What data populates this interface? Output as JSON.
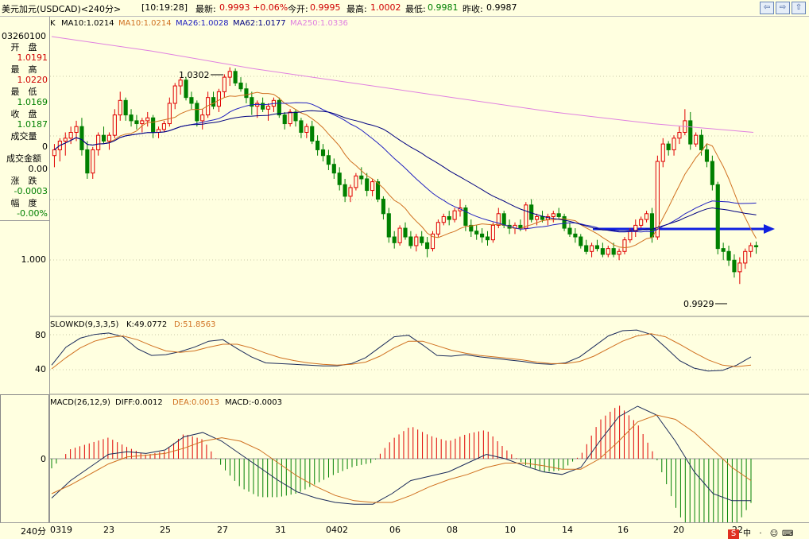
{
  "header": {
    "symbol": "美元加元(USDCAD)<240分>",
    "time": "[10:19:28]",
    "latest_label": "最新:",
    "latest_value": "0.9993 +0.06%",
    "open_label": "今开:",
    "open_value": "0.9995",
    "high_label": "最高:",
    "high_value": "1.0002",
    "low_label": "最低:",
    "low_value": "0.9981",
    "prev_label": "昨收:",
    "prev_value": "0.9987"
  },
  "nav_buttons": [
    "⇦",
    "⇨",
    "⇧"
  ],
  "ma_legend": {
    "k": "K",
    "ma10a": "MA10:1.0214",
    "ma10b": "MA10:1.0214",
    "ma26": "MA26:1.0028",
    "ma62": "MA62:1.0177",
    "ma250": "MA250:1.0336"
  },
  "info_panel": {
    "datetime": "03260100",
    "open_label": "开　盘",
    "open_value": "1.0191",
    "high_label": "最　高",
    "high_value": "1.0220",
    "low_label": "最　低",
    "low_value": "1.0169",
    "close_label": "收　盘",
    "close_value": "1.0187",
    "volume_label": "成交量",
    "volume_value": "0",
    "amount_label": "成交金额",
    "amount_value": "0.00",
    "change_label": "涨　跌",
    "change_value": "-0.0003",
    "pct_label": "幅　度",
    "pct_value": "-0.00%"
  },
  "price_axis": {
    "tick": "1.000"
  },
  "annotations": {
    "high": "1.0302",
    "low": "0.9929"
  },
  "kd": {
    "legend_name": "SLOWKD(9,3,3,5)",
    "legend_k": "K:49.0772",
    "legend_d": "D:51.8563",
    "ticks": [
      "80",
      "40"
    ]
  },
  "macd": {
    "legend_name": "MACD(26,12,9)",
    "legend_diff": "DIFF:0.0012",
    "legend_dea": "DEA:0.0013",
    "legend_macd": "MACD:-0.0003",
    "tick": "0"
  },
  "dates": {
    "period": "240分",
    "labels": [
      "0319",
      "23",
      "25",
      "27",
      "31",
      "0402",
      "06",
      "08",
      "10",
      "14",
      "16",
      "20",
      "22"
    ]
  },
  "ime": [
    "S",
    "中",
    "·",
    "☺",
    "⌨"
  ],
  "colors": {
    "up": "#E00000",
    "down": "#008000",
    "ma10": "#D07020",
    "ma26": "#2020C0",
    "ma62": "#000080",
    "ma250": "#E080E0",
    "arrow": "#1020E0"
  },
  "chart_data": {
    "type": "candlestick",
    "instrument": "USDCAD",
    "interval": "240分",
    "price_range": [
      0.988,
      1.037
    ],
    "kd_range": [
      0,
      100
    ],
    "candles_ohlc": [
      [
        1.015,
        1.017,
        1.013,
        1.016
      ],
      [
        1.016,
        1.018,
        1.014,
        1.0175
      ],
      [
        1.0175,
        1.019,
        1.015,
        1.018
      ],
      [
        1.018,
        1.02,
        1.017,
        1.019
      ],
      [
        1.019,
        1.021,
        1.0175,
        1.02
      ],
      [
        1.02,
        1.0215,
        1.015,
        1.016
      ],
      [
        1.016,
        1.0175,
        1.011,
        1.012
      ],
      [
        1.012,
        1.0165,
        1.011,
        1.016
      ],
      [
        1.016,
        1.019,
        1.015,
        1.0185
      ],
      [
        1.0185,
        1.02,
        1.017,
        1.0175
      ],
      [
        1.0175,
        1.019,
        1.016,
        1.0185
      ],
      [
        1.0185,
        1.023,
        1.018,
        1.022
      ],
      [
        1.022,
        1.026,
        1.021,
        1.0245
      ],
      [
        1.0245,
        1.025,
        1.021,
        1.022
      ],
      [
        1.022,
        1.023,
        1.02,
        1.021
      ],
      [
        1.021,
        1.022,
        1.0195,
        1.0205
      ],
      [
        1.0205,
        1.0215,
        1.019,
        1.021
      ],
      [
        1.021,
        1.0225,
        1.02,
        1.0215
      ],
      [
        1.0215,
        1.022,
        1.018,
        1.019
      ],
      [
        1.019,
        1.02,
        1.018,
        1.0195
      ],
      [
        1.0195,
        1.021,
        1.019,
        1.0205
      ],
      [
        1.0205,
        1.025,
        1.02,
        1.024
      ],
      [
        1.024,
        1.0275,
        1.023,
        1.027
      ],
      [
        1.027,
        1.0285,
        1.0255,
        1.028
      ],
      [
        1.028,
        1.0285,
        1.0245,
        1.025
      ],
      [
        1.025,
        1.026,
        1.023,
        1.024
      ],
      [
        1.024,
        1.0245,
        1.02,
        1.021
      ],
      [
        1.021,
        1.023,
        1.0195,
        1.022
      ],
      [
        1.022,
        1.026,
        1.0215,
        1.025
      ],
      [
        1.025,
        1.026,
        1.023,
        1.0235
      ],
      [
        1.0235,
        1.0265,
        1.0225,
        1.026
      ],
      [
        1.026,
        1.029,
        1.025,
        1.0285
      ],
      [
        1.0285,
        1.0302,
        1.027,
        1.0295
      ],
      [
        1.0295,
        1.03,
        1.027,
        1.0275
      ],
      [
        1.0275,
        1.0285,
        1.026,
        1.0265
      ],
      [
        1.0265,
        1.0275,
        1.024,
        1.025
      ],
      [
        1.025,
        1.026,
        1.022,
        1.0235
      ],
      [
        1.0235,
        1.0245,
        1.0215,
        1.024
      ],
      [
        1.024,
        1.025,
        1.0225,
        1.023
      ],
      [
        1.023,
        1.024,
        1.021,
        1.0235
      ],
      [
        1.0235,
        1.025,
        1.0225,
        1.0245
      ],
      [
        1.0245,
        1.025,
        1.0215,
        1.022
      ],
      [
        1.022,
        1.0225,
        1.0195,
        1.0205
      ],
      [
        1.0205,
        1.023,
        1.02,
        1.0225
      ],
      [
        1.0225,
        1.023,
        1.02,
        1.021
      ],
      [
        1.021,
        1.0215,
        1.018,
        1.019
      ],
      [
        1.019,
        1.0205,
        1.018,
        1.02
      ],
      [
        1.02,
        1.021,
        1.017,
        1.0175
      ],
      [
        1.0175,
        1.0185,
        1.015,
        1.016
      ],
      [
        1.016,
        1.017,
        1.014,
        1.015
      ],
      [
        1.015,
        1.016,
        1.0125,
        1.0135
      ],
      [
        1.0135,
        1.0145,
        1.011,
        1.012
      ],
      [
        1.012,
        1.013,
        1.009,
        1.01
      ],
      [
        1.01,
        1.011,
        1.007,
        1.008
      ],
      [
        1.008,
        1.01,
        1.007,
        1.0095
      ],
      [
        1.0095,
        1.012,
        1.009,
        1.0115
      ],
      [
        1.0115,
        1.013,
        1.01,
        1.011
      ],
      [
        1.011,
        1.012,
        1.008,
        1.009
      ],
      [
        1.009,
        1.011,
        1.008,
        1.0105
      ],
      [
        1.0105,
        1.011,
        1.007,
        1.0075
      ],
      [
        1.0075,
        1.008,
        1.004,
        1.005
      ],
      [
        1.005,
        1.006,
        1.0,
        1.001
      ],
      [
        1.001,
        1.002,
        0.999,
        1.0
      ],
      [
        1.0,
        1.003,
        0.9995,
        1.0025
      ],
      [
        1.0025,
        1.0035,
        1.0005,
        1.001
      ],
      [
        1.001,
        1.002,
        0.999,
        0.9995
      ],
      [
        0.9995,
        1.0015,
        0.9985,
        1.001
      ],
      [
        1.001,
        1.002,
        0.9995,
        1.0
      ],
      [
        1.0,
        1.001,
        0.9975,
        0.999
      ],
      [
        0.999,
        1.002,
        0.9985,
        1.0015
      ],
      [
        1.0015,
        1.004,
        1.001,
        1.0035
      ],
      [
        1.0035,
        1.005,
        1.003,
        1.0045
      ],
      [
        1.0045,
        1.0055,
        1.003,
        1.004
      ],
      [
        1.004,
        1.006,
        1.0035,
        1.0055
      ],
      [
        1.0055,
        1.0075,
        1.0045,
        1.006
      ],
      [
        1.006,
        1.0065,
        1.002,
        1.003
      ],
      [
        1.003,
        1.004,
        1.001,
        1.002
      ],
      [
        1.002,
        1.003,
        1.0005,
        1.0015
      ],
      [
        1.0015,
        1.0025,
        1.0,
        1.001
      ],
      [
        1.001,
        1.002,
        0.9995,
        1.0005
      ],
      [
        1.0005,
        1.0035,
        1.0,
        1.003
      ],
      [
        1.003,
        1.006,
        1.0025,
        1.005
      ],
      [
        1.005,
        1.0055,
        1.0025,
        1.003
      ],
      [
        1.003,
        1.004,
        1.0015,
        1.0025
      ],
      [
        1.0025,
        1.0035,
        1.0015,
        1.003
      ],
      [
        1.003,
        1.004,
        1.002,
        1.0025
      ],
      [
        1.0025,
        1.007,
        1.002,
        1.0065
      ],
      [
        1.0065,
        1.0075,
        1.0035,
        1.004
      ],
      [
        1.004,
        1.005,
        1.003,
        1.0045
      ],
      [
        1.0045,
        1.0055,
        1.0035,
        1.004
      ],
      [
        1.004,
        1.005,
        1.003,
        1.0045
      ],
      [
        1.0045,
        1.0055,
        1.0035,
        1.005
      ],
      [
        1.005,
        1.006,
        1.004,
        1.0045
      ],
      [
        1.0045,
        1.005,
        1.002,
        1.0025
      ],
      [
        1.0025,
        1.0035,
        1.001,
        1.0015
      ],
      [
        1.0015,
        1.0025,
        1.0,
        1.001
      ],
      [
        1.001,
        1.0015,
        0.999,
        0.9995
      ],
      [
        0.9995,
        1.0005,
        0.998,
        0.9985
      ],
      [
        0.9985,
        1.0,
        0.9975,
        0.9995
      ],
      [
        0.9995,
        1.0005,
        0.9985,
        0.999
      ],
      [
        0.999,
        1.0,
        0.9975,
        0.998
      ],
      [
        0.998,
        0.9995,
        0.9975,
        0.999
      ],
      [
        0.999,
        1.0,
        0.9975,
        0.998
      ],
      [
        0.998,
        0.999,
        0.997,
        0.9985
      ],
      [
        0.9985,
        1.001,
        0.998,
        1.0005
      ],
      [
        1.0005,
        1.0025,
        1.0,
        1.002
      ],
      [
        1.002,
        1.004,
        1.001,
        1.003
      ],
      [
        1.003,
        1.0045,
        1.0025,
        1.004
      ],
      [
        1.004,
        1.0055,
        1.0035,
        1.005
      ],
      [
        1.005,
        1.006,
        1.0,
        1.001
      ],
      [
        1.001,
        1.015,
        1.0005,
        1.014
      ],
      [
        1.014,
        1.018,
        1.013,
        1.017
      ],
      [
        1.017,
        1.0175,
        1.015,
        1.016
      ],
      [
        1.016,
        1.0185,
        1.015,
        1.018
      ],
      [
        1.018,
        1.02,
        1.017,
        1.019
      ],
      [
        1.019,
        1.023,
        1.0185,
        1.021
      ],
      [
        1.021,
        1.0225,
        1.016,
        1.017
      ],
      [
        1.017,
        1.019,
        1.0165,
        1.0185
      ],
      [
        1.0185,
        1.0195,
        1.015,
        1.016
      ],
      [
        1.016,
        1.017,
        1.013,
        1.014
      ],
      [
        1.014,
        1.015,
        1.009,
        1.01
      ],
      [
        1.01,
        1.0105,
        0.998,
        0.999
      ],
      [
        0.999,
        1.0,
        0.997,
        0.9985
      ],
      [
        0.9985,
        0.9995,
        0.996,
        0.997
      ],
      [
        0.997,
        0.998,
        0.994,
        0.995
      ],
      [
        0.995,
        0.9975,
        0.9929,
        0.9965
      ],
      [
        0.9965,
        0.999,
        0.9955,
        0.9985
      ],
      [
        0.9985,
        1.0,
        0.9975,
        0.9995
      ],
      [
        0.9995,
        1.0002,
        0.9981,
        0.9993
      ]
    ],
    "ma250": [
      1.0355,
      1.033,
      1.03,
      1.0275,
      1.025,
      1.0225,
      1.0205,
      1.019
    ],
    "kd_k": [
      38,
      62,
      74,
      79,
      81,
      76,
      60,
      51,
      52,
      56,
      62,
      70,
      72,
      60,
      49,
      41,
      40,
      39,
      38,
      37,
      37,
      40,
      48,
      62,
      76,
      78,
      65,
      51,
      50,
      52,
      49,
      47,
      45,
      43,
      40,
      39,
      41,
      49,
      63,
      77,
      84,
      85,
      79,
      62,
      44,
      34,
      30,
      31,
      38,
      49
    ],
    "kd_d": [
      33,
      48,
      61,
      70,
      75,
      77,
      72,
      64,
      57,
      55,
      57,
      62,
      66,
      66,
      61,
      54,
      48,
      44,
      41,
      39,
      38,
      39,
      42,
      50,
      61,
      70,
      70,
      64,
      58,
      54,
      51,
      49,
      47,
      45,
      42,
      40,
      40,
      43,
      50,
      60,
      70,
      77,
      80,
      76,
      66,
      55,
      45,
      38,
      36,
      38
    ],
    "macd_diff": [
      -0.0045,
      -0.0025,
      -0.001,
      0.0005,
      0.0008,
      0.0006,
      0.001,
      0.0025,
      0.003,
      0.002,
      0.0005,
      -0.001,
      -0.0025,
      -0.0038,
      -0.0045,
      -0.005,
      -0.0052,
      -0.0052,
      -0.004,
      -0.0025,
      -0.002,
      -0.0015,
      -0.0005,
      0.0005,
      0.0,
      -0.0008,
      -0.0015,
      -0.0018,
      -0.001,
      0.002,
      0.0048,
      0.006,
      0.005,
      0.002,
      -0.0015,
      -0.004,
      -0.0048,
      -0.0048
    ],
    "macd_dea": [
      -0.004,
      -0.003,
      -0.0018,
      -0.0006,
      0.0002,
      0.0004,
      0.0006,
      0.0012,
      0.002,
      0.0024,
      0.002,
      0.001,
      -0.0005,
      -0.002,
      -0.0032,
      -0.0042,
      -0.0048,
      -0.005,
      -0.005,
      -0.0042,
      -0.0032,
      -0.0024,
      -0.0018,
      -0.001,
      -0.0005,
      -0.0005,
      -0.0008,
      -0.0012,
      -0.0012,
      0.0,
      0.002,
      0.0042,
      0.005,
      0.0045,
      0.003,
      0.001,
      -0.001,
      -0.0025
    ]
  }
}
